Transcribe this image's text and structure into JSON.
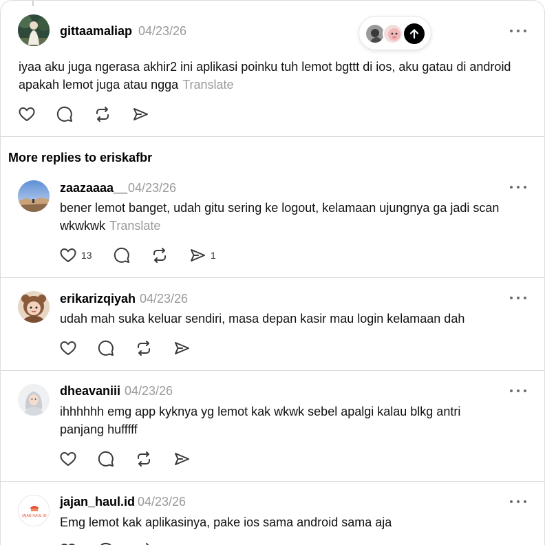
{
  "top_post": {
    "username": "gittaamaliap",
    "date": "04/23/26",
    "text": "iyaa aku juga ngerasa akhir2 ini aplikasi poinku tuh lemot bgttt di ios, aku gatau di android apakah lemot juga atau ngga",
    "translate": "Translate",
    "avatar_icon": "avatar-photo-woman-outdoor"
  },
  "reply_indicator": {
    "avatars": [
      "avatar-dark-photo",
      "avatar-pink-cartoon"
    ],
    "icon": "arrow-up-icon"
  },
  "section_title": "More replies to eriskafbr",
  "replies": [
    {
      "username": "zaazaaaa__",
      "date": "04/23/26",
      "text": "bener lemot banget, udah gitu sering ke logout, kelamaan ujungnya ga jadi scan wkwkwk",
      "translate": "Translate",
      "like_count": "13",
      "share_count": "1",
      "avatar_icon": "avatar-landscape-sky"
    },
    {
      "username": "erikarizqiyah",
      "date": "04/23/26",
      "text": "udah mah suka keluar sendiri, masa depan kasir mau login kelamaan dah",
      "avatar_icon": "avatar-child-bear-hat"
    },
    {
      "username": "dheavaniii",
      "date": "04/23/26",
      "text": "ihhhhhh emg app kyknya yg lemot kak wkwk sebel apalgi kalau blkg antri panjang hufffff",
      "avatar_icon": "avatar-hijab-illustration"
    },
    {
      "username": "jajan_haul.id",
      "date": "04/23/26",
      "text": "Emg lemot kak aplikasinya, pake ios sama android sama aja",
      "avatar_icon": "avatar-jajan-haul-logo",
      "logo_text": "JAJAN HAUL ID"
    }
  ],
  "colors": {
    "text": "#111111",
    "muted": "#9a9a9a",
    "divider": "#d9d9d9",
    "icon": "#3a3a3a"
  }
}
